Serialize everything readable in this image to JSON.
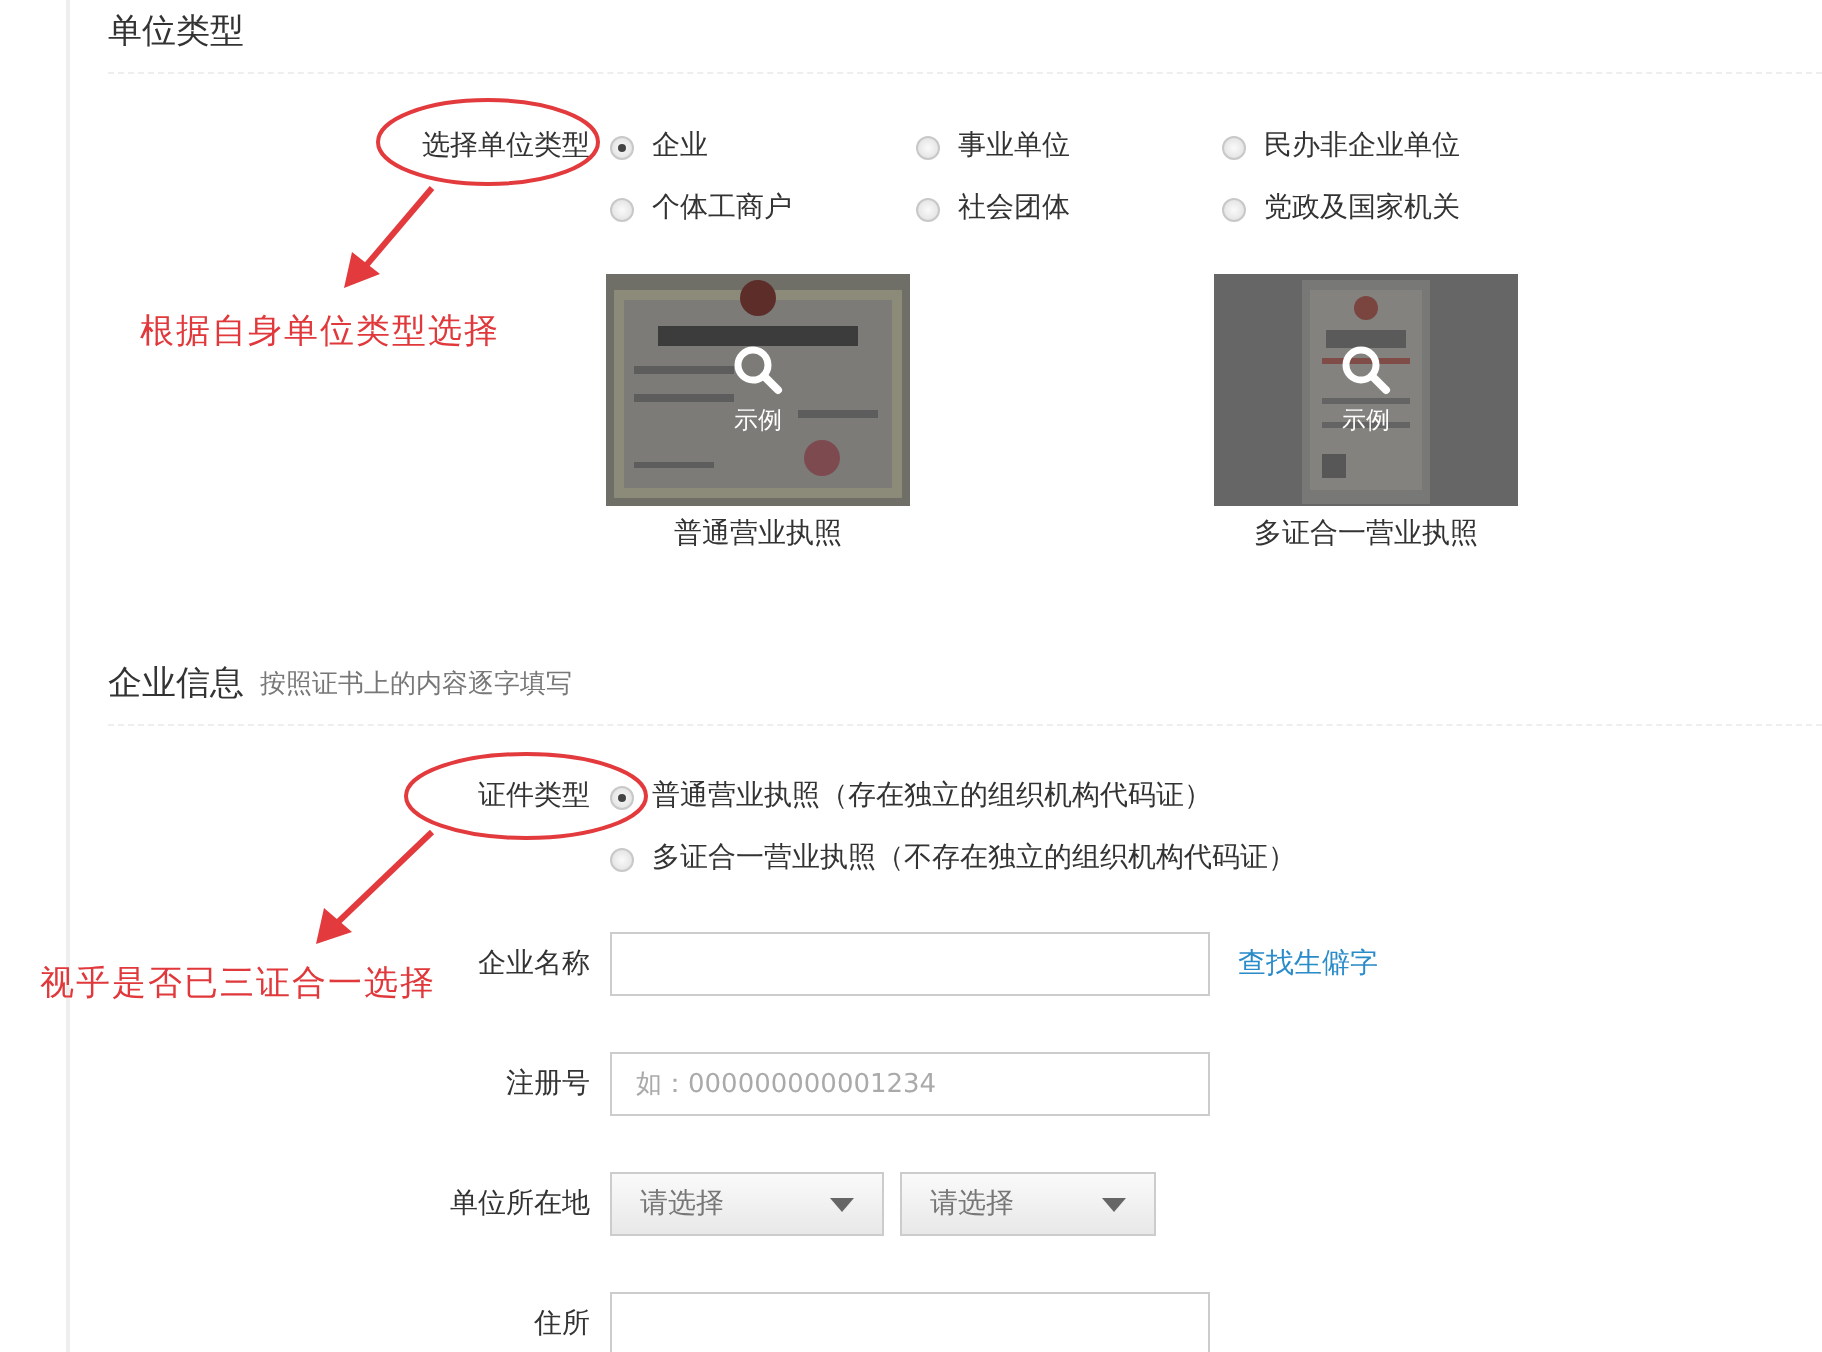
{
  "unit_section": {
    "title": "单位类型"
  },
  "unit_type": {
    "label": "选择单位类型",
    "options": [
      {
        "label": "企业",
        "selected": true
      },
      {
        "label": "事业单位",
        "selected": false
      },
      {
        "label": "民办非企业单位",
        "selected": false
      },
      {
        "label": "个体工商户",
        "selected": false
      },
      {
        "label": "社会团体",
        "selected": false
      },
      {
        "label": "党政及国家机关",
        "selected": false
      }
    ]
  },
  "examples": [
    {
      "kind": "landscape",
      "badge": "示例",
      "caption": "普通营业执照"
    },
    {
      "kind": "portrait",
      "badge": "示例",
      "caption": "多证合一营业执照"
    }
  ],
  "company_section": {
    "title": "企业信息",
    "hint": "按照证书上的内容逐字填写"
  },
  "cert_type": {
    "label": "证件类型",
    "options": [
      {
        "label": "普通营业执照（存在独立的组织机构代码证）",
        "selected": true
      },
      {
        "label": "多证合一营业执照（不存在独立的组织机构代码证）",
        "selected": false
      }
    ]
  },
  "fields": [
    {
      "kind": "text",
      "label": "企业名称",
      "link": "查找生僻字"
    },
    {
      "kind": "text",
      "label": "注册号",
      "placeholder": "如：000000000001234"
    },
    {
      "kind": "selects",
      "label": "单位所在地",
      "selects": [
        "请选择",
        "请选择"
      ]
    },
    {
      "kind": "text",
      "label": "住所"
    }
  ],
  "annotations": [
    {
      "text": "根据自身单位类型选择"
    },
    {
      "text": "视乎是否已三证合一选择"
    }
  ]
}
